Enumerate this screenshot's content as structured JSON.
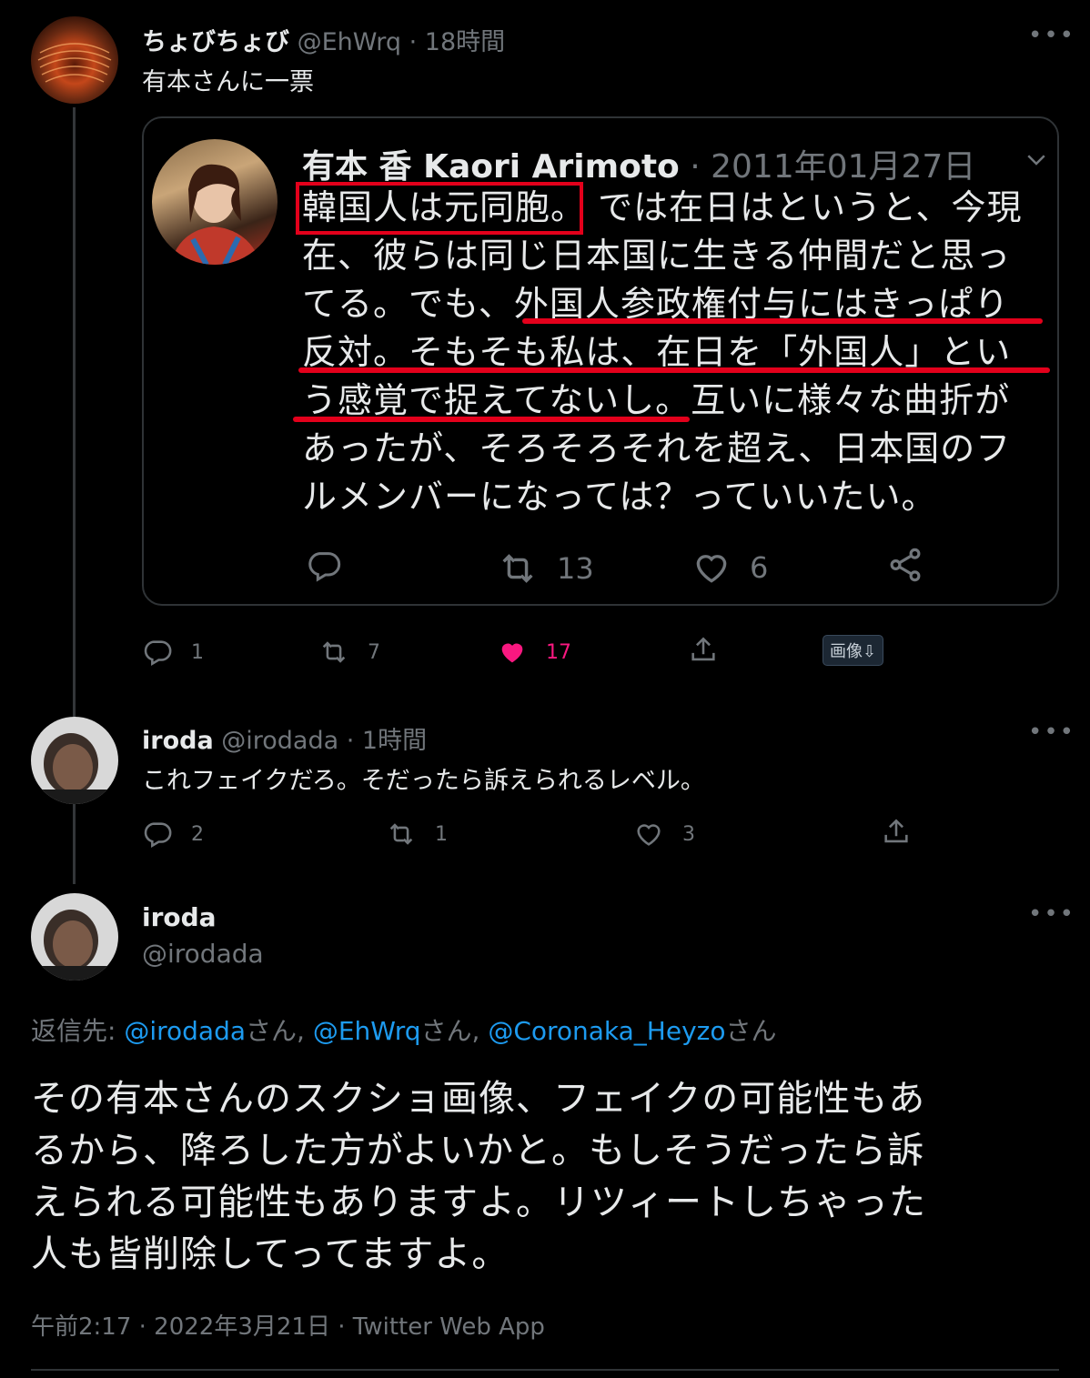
{
  "tweet1": {
    "display_name": "ちょびちょび",
    "handle": "@EhWrq",
    "time": "18時間",
    "text": "有本さんに一票",
    "more": "•••",
    "actions": {
      "reply": "1",
      "retweet": "7",
      "like": "17"
    },
    "image_badge": "画像⇩"
  },
  "quote": {
    "display_name": "有本 香 Kaori Arimoto",
    "date": "· 2011年01月27日",
    "lines": [
      "韓国人は元同胞。 では在日はというと、今現",
      "在、彼らは同じ日本国に生きる仲間だと思っ",
      "てる。でも、外国人参政権付与にはきっぱり",
      "反対。そもそも私は、在日を「外国人」とい",
      "う感覚で捉えてないし。互いに様々な曲折が",
      "あったが、そろそろそれを超え、日本国のフ",
      "ルメンバーになっては？っていいたい。"
    ],
    "actions": {
      "retweet": "13",
      "like": "6"
    }
  },
  "tweet2": {
    "display_name": "iroda",
    "handle": "@irodada",
    "time": "· 1時間",
    "text": "これフェイクだろ。そだったら訴えられるレベル。",
    "more": "•••",
    "actions": {
      "reply": "2",
      "retweet": "1",
      "like": "3"
    }
  },
  "tweet3": {
    "display_name": "iroda",
    "handle": "@irodada",
    "more": "•••",
    "reply_to_label": "返信先:",
    "reply_to": [
      {
        "handle": "@irodada",
        "suffix": "さん,"
      },
      {
        "handle": "@EhWrq",
        "suffix": "さん,"
      },
      {
        "handle": "@Coronaka_Heyzo",
        "suffix": "さん"
      }
    ],
    "lines": [
      "その有本さんのスクショ画像、フェイクの可能性もあ",
      "るから、降ろした方がよいかと。もしそうだったら訴",
      "えられる可能性もありますよ。リツィートしちゃった",
      "人も皆削除してってますよ。"
    ],
    "meta": "午前2:17 · 2022年3月21日 · Twitter Web App"
  },
  "colors": {
    "accent": "#1d9bf0",
    "like": "#f91880",
    "annotation": "#e3001b"
  }
}
